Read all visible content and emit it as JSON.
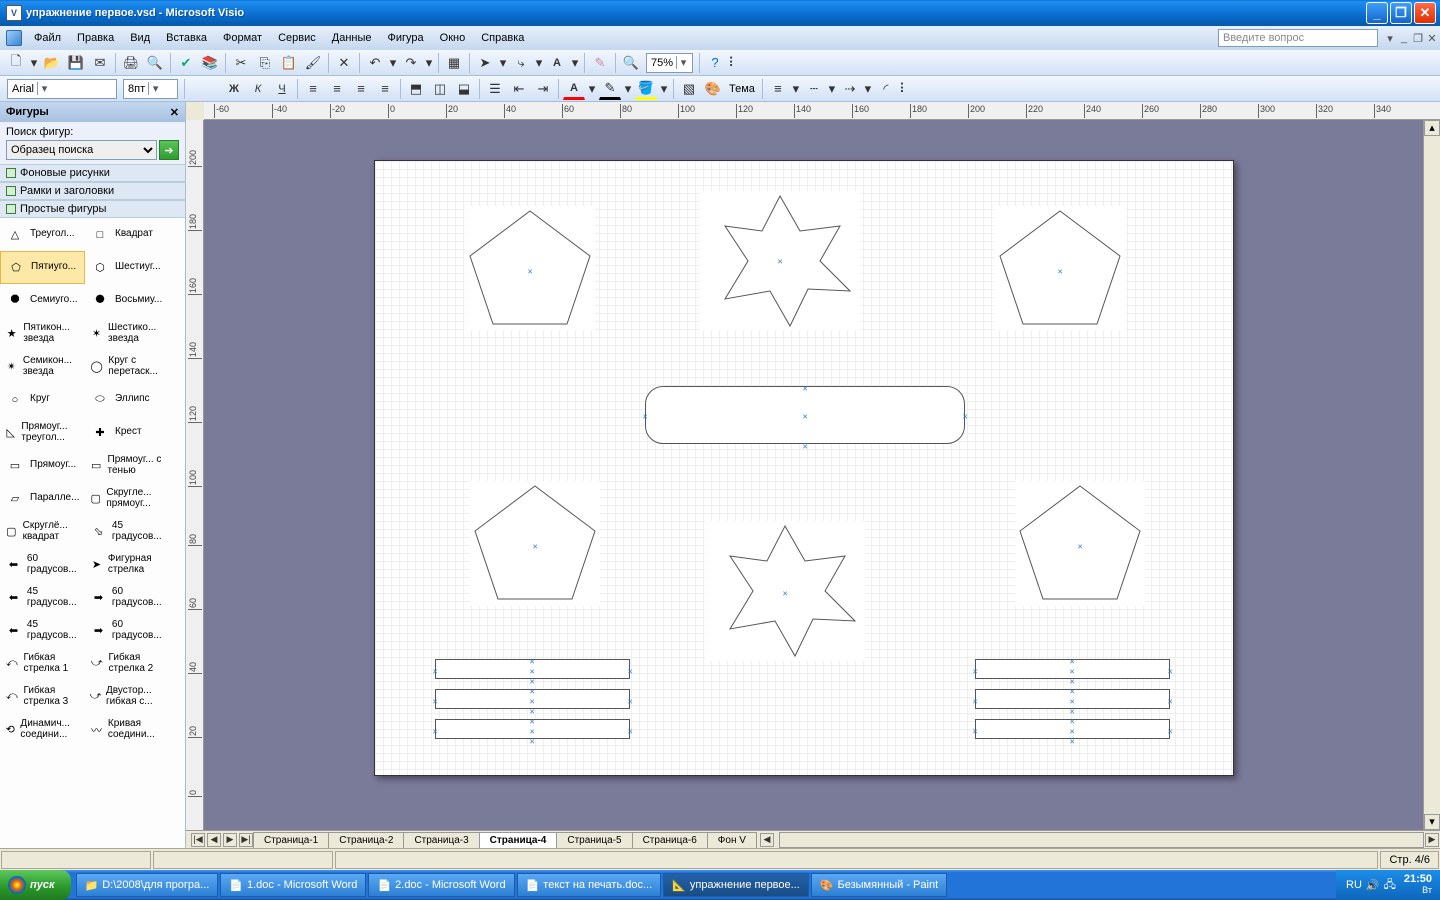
{
  "title": "упражнение первое.vsd - Microsoft Visio",
  "menu": [
    "Файл",
    "Правка",
    "Вид",
    "Вставка",
    "Формат",
    "Сервис",
    "Данные",
    "Фигура",
    "Окно",
    "Справка"
  ],
  "help_placeholder": "Введите вопрос",
  "zoom": "75%",
  "font_name": "Arial",
  "font_size": "8пт",
  "theme_label": "Тема",
  "side": {
    "title": "Фигуры",
    "search_label": "Поиск фигур:",
    "search_value": "Образец поиска",
    "stencils": [
      "Фоновые рисунки",
      "Рамки и заголовки",
      "Простые фигуры"
    ]
  },
  "shapes_palette": [
    [
      "Треугол...",
      "Квадрат"
    ],
    [
      "Пятиуго...",
      "Шестиуг..."
    ],
    [
      "Семиуго...",
      "Восьмиу..."
    ],
    [
      "Пятикон... звезда",
      "Шестико... звезда"
    ],
    [
      "Семикон... звезда",
      "Круг с перетаск..."
    ],
    [
      "Круг",
      "Эллипс"
    ],
    [
      "Прямоуг... треугол...",
      "Крест"
    ],
    [
      "Прямоуг...",
      "Прямоуг... с тенью"
    ],
    [
      "Паралле...",
      "Скругле... прямоуг..."
    ],
    [
      "Скруглё... квадрат",
      "45 градусов..."
    ],
    [
      "60 градусов...",
      "Фигурная стрелка"
    ],
    [
      "45 градусов...",
      "60 градусов..."
    ],
    [
      "45 градусов...",
      "60 градусов..."
    ],
    [
      "Гибкая стрелка 1",
      "Гибкая стрелка 2"
    ],
    [
      "Гибкая стрелка 3",
      "Двустор... гибкая с..."
    ],
    [
      "Динамич... соедини...",
      "Кривая соедини..."
    ]
  ],
  "ruler_h": [
    "-60",
    "-40",
    "-20",
    "0",
    "20",
    "40",
    "60",
    "80",
    "100",
    "120",
    "140",
    "160",
    "180",
    "200",
    "220",
    "240",
    "260",
    "280",
    "300",
    "320",
    "340"
  ],
  "ruler_v": [
    "200",
    "180",
    "160",
    "140",
    "120",
    "100",
    "80",
    "60",
    "40",
    "20",
    "0"
  ],
  "page_tabs": [
    "Страница-1",
    "Страница-2",
    "Страница-3",
    "Страница-4",
    "Страница-5",
    "Страница-6",
    "Фон V"
  ],
  "active_tab_index": 3,
  "status_page": "Стр. 4/6",
  "taskbar": {
    "start": "пуск",
    "items": [
      "D:\\2008\\для програ...",
      "1.doc - Microsoft Word",
      "2.doc - Microsoft Word",
      "текст на печать.doc...",
      "упражнение первое...",
      "Безымянный - Paint"
    ],
    "active_index": 4,
    "clock": "21:50",
    "clock_sub": "Вт"
  }
}
